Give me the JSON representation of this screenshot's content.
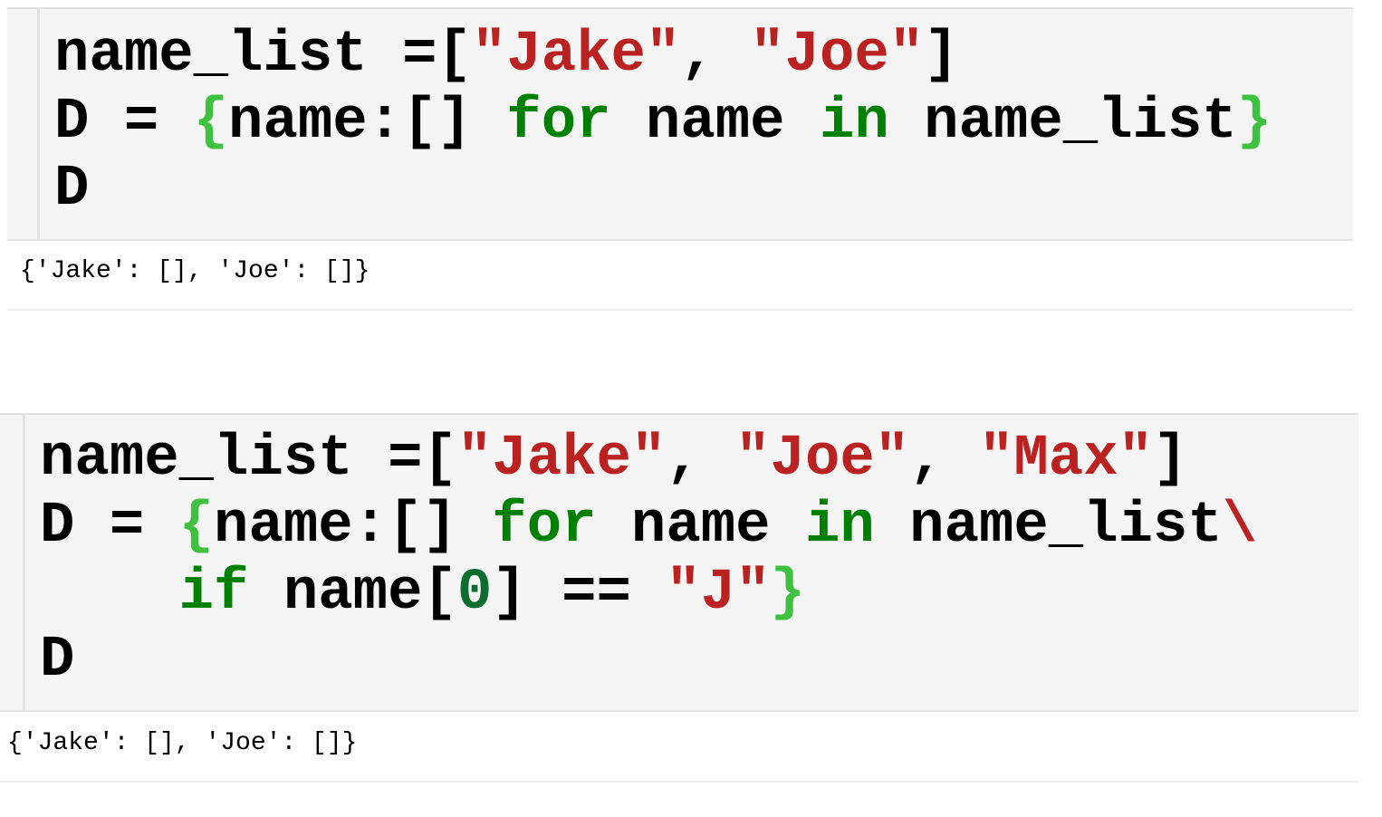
{
  "cells": [
    {
      "lines": [
        [
          [
            "name_list =[",
            ""
          ],
          [
            "\"Jake\"",
            "s"
          ],
          [
            ", ",
            ""
          ],
          [
            "\"Joe\"",
            "s"
          ],
          [
            "]",
            ""
          ]
        ],
        [
          [
            "D = ",
            ""
          ],
          [
            "{",
            "b"
          ],
          [
            "name:[] ",
            ""
          ],
          [
            "for",
            "k"
          ],
          [
            " name ",
            ""
          ],
          [
            "in",
            "k"
          ],
          [
            " name_list",
            ""
          ],
          [
            "}",
            "b"
          ]
        ],
        [
          [
            "D",
            ""
          ]
        ]
      ],
      "output": "{'Jake': [], 'Joe': []}"
    },
    {
      "lines": [
        [
          [
            "name_list =[",
            ""
          ],
          [
            "\"Jake\"",
            "s"
          ],
          [
            ", ",
            ""
          ],
          [
            "\"Joe\"",
            "s"
          ],
          [
            ", ",
            ""
          ],
          [
            "\"Max\"",
            "s"
          ],
          [
            "]",
            ""
          ]
        ],
        [
          [
            "D = ",
            ""
          ],
          [
            "{",
            "b"
          ],
          [
            "name:[] ",
            ""
          ],
          [
            "for",
            "k"
          ],
          [
            " name ",
            ""
          ],
          [
            "in",
            "k"
          ],
          [
            " name_list",
            ""
          ],
          [
            "\\",
            "s"
          ]
        ],
        [
          [
            "    ",
            ""
          ],
          [
            "if",
            "k"
          ],
          [
            " name[",
            ""
          ],
          [
            "0",
            "n"
          ],
          [
            "] == ",
            ""
          ],
          [
            "\"J\"",
            "s"
          ],
          [
            "}",
            "b"
          ]
        ],
        [
          [
            "D",
            ""
          ]
        ]
      ],
      "output": "{'Jake': [], 'Joe': []}"
    }
  ]
}
